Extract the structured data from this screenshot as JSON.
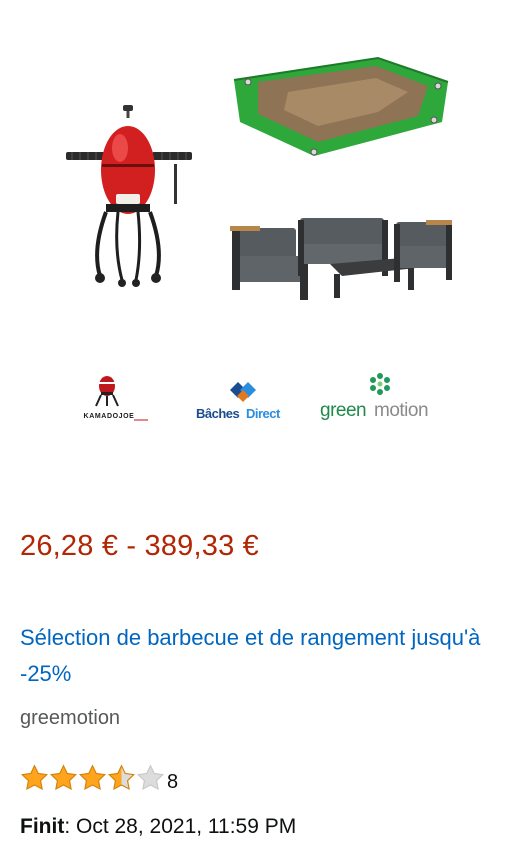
{
  "products": [
    {
      "name": "kamado-grill",
      "icon": "kamado-grill-image"
    },
    {
      "name": "tarpaulin",
      "icon": "green-tarp-image"
    },
    {
      "name": "garden-lounge-set",
      "icon": "outdoor-sofa-image"
    }
  ],
  "brands": {
    "kamado": {
      "text": "KAMADOJOE",
      "color": "#c0161d"
    },
    "baches": {
      "text_a": "Bâches",
      "text_b": "Direct",
      "color_a": "#1a4d8f",
      "color_b": "#2b8de0"
    },
    "green": {
      "text_a": "green",
      "text_b": "motion",
      "color_a": "#1f8a4c",
      "color_b": "#8a8a8a"
    }
  },
  "price_range": "26,28 € - 389,33 €",
  "title": "Sélection de barbecue et de rangement jusqu'à -25%",
  "brand": "greemotion",
  "rating": {
    "value": 3.5,
    "max": 5,
    "count": "8"
  },
  "deadline": {
    "label": "Finit",
    "separator": ": ",
    "value": "Oct 28, 2021, 11:59 PM"
  },
  "colors": {
    "price": "#b12704",
    "link": "#0066c0",
    "star": "#ffa41c",
    "star_empty": "#dcdcdc"
  }
}
